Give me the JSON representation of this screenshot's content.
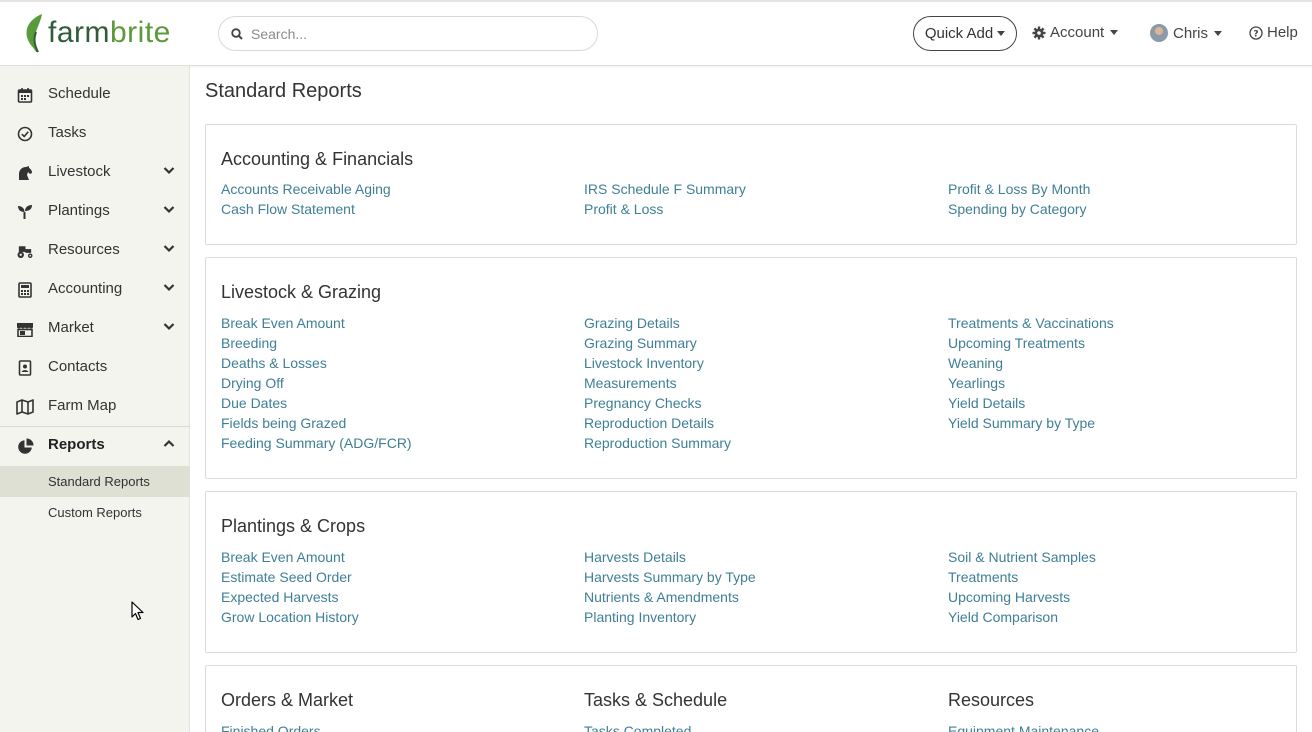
{
  "header": {
    "logo_text_a": "farm",
    "logo_text_b": "brite",
    "search_placeholder": "Search...",
    "quick_add": "Quick Add",
    "account": "Account",
    "user": "Chris",
    "help": "Help"
  },
  "sidebar": {
    "items": [
      {
        "label": "Schedule",
        "icon": "calendar-icon",
        "expandable": false
      },
      {
        "label": "Tasks",
        "icon": "check-circle-icon",
        "expandable": false
      },
      {
        "label": "Livestock",
        "icon": "horse-icon",
        "expandable": true
      },
      {
        "label": "Plantings",
        "icon": "seedling-icon",
        "expandable": true
      },
      {
        "label": "Resources",
        "icon": "tractor-icon",
        "expandable": true
      },
      {
        "label": "Accounting",
        "icon": "calculator-icon",
        "expandable": true
      },
      {
        "label": "Market",
        "icon": "store-icon",
        "expandable": true
      },
      {
        "label": "Contacts",
        "icon": "address-book-icon",
        "expandable": false
      },
      {
        "label": "Farm Map",
        "icon": "map-icon",
        "expandable": false
      },
      {
        "label": "Reports",
        "icon": "pie-chart-icon",
        "expandable": true
      }
    ],
    "sub_items": [
      {
        "label": "Standard Reports",
        "active": true
      },
      {
        "label": "Custom Reports",
        "active": false
      }
    ]
  },
  "main": {
    "title": "Standard Reports",
    "sections": [
      {
        "title": "Accounting & Financials",
        "columns": [
          [
            "Accounts Receivable Aging",
            "Cash Flow Statement"
          ],
          [
            "IRS Schedule F Summary",
            "Profit & Loss"
          ],
          [
            "Profit & Loss By Month",
            "Spending by Category"
          ]
        ]
      },
      {
        "title": "Livestock & Grazing",
        "columns": [
          [
            "Break Even Amount",
            "Breeding",
            "Deaths & Losses",
            "Drying Off",
            "Due Dates",
            "Fields being Grazed",
            "Feeding Summary (ADG/FCR)"
          ],
          [
            "Grazing Details",
            "Grazing Summary",
            "Livestock Inventory",
            "Measurements",
            "Pregnancy Checks",
            "Reproduction Details",
            "Reproduction Summary"
          ],
          [
            "Treatments & Vaccinations",
            "Upcoming Treatments",
            "Weaning",
            "Yearlings",
            "Yield Details",
            "Yield Summary by Type"
          ]
        ]
      },
      {
        "title": "Plantings & Crops",
        "columns": [
          [
            "Break Even Amount",
            "Estimate Seed Order",
            "Expected Harvests",
            "Grow Location History"
          ],
          [
            "Harvests Details",
            "Harvests Summary by Type",
            "Nutrients & Amendments",
            "Planting Inventory"
          ],
          [
            "Soil & Nutrient Samples",
            "Treatments",
            "Upcoming Harvests",
            "Yield Comparison"
          ]
        ]
      }
    ],
    "last_row": [
      {
        "title": "Orders & Market",
        "links": [
          "Finished Orders"
        ]
      },
      {
        "title": "Tasks & Schedule",
        "links": [
          "Tasks Completed"
        ]
      },
      {
        "title": "Resources",
        "links": [
          "Equipment Maintenance"
        ]
      }
    ]
  },
  "colors": {
    "link": "#3f7f96",
    "sidebar_bg": "#f4f4ef",
    "active_sub": "#dde0d2",
    "logo_dark": "#2f5d3a",
    "logo_light": "#5a9a3a"
  }
}
